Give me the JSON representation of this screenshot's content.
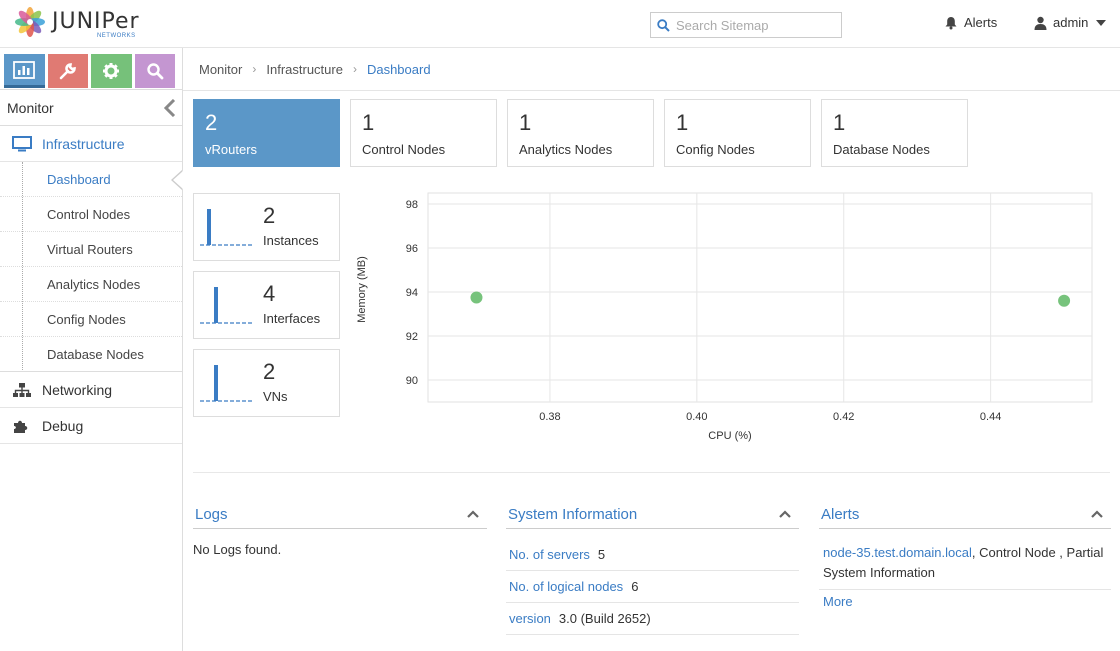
{
  "header": {
    "logo_text": "JUNIPer",
    "logo_sub": "NETWORKS",
    "search_placeholder": "Search Sitemap",
    "alerts_label": "Alerts",
    "user_label": "admin"
  },
  "sidebar": {
    "title": "Monitor",
    "sections": {
      "infrastructure": "Infrastructure",
      "networking": "Networking",
      "debug": "Debug"
    },
    "items": [
      "Dashboard",
      "Control Nodes",
      "Virtual Routers",
      "Analytics Nodes",
      "Config Nodes",
      "Database Nodes"
    ],
    "tab_colors": {
      "monitor": "#5b97c8",
      "configure": "#e07a73",
      "setting": "#76c17a",
      "query": "#c496d1"
    }
  },
  "breadcrumb": {
    "level1": "Monitor",
    "level2": "Infrastructure",
    "current": "Dashboard"
  },
  "tiles": [
    {
      "count": "2",
      "label": "vRouters"
    },
    {
      "count": "1",
      "label": "Control Nodes"
    },
    {
      "count": "1",
      "label": "Analytics Nodes"
    },
    {
      "count": "1",
      "label": "Config Nodes"
    },
    {
      "count": "1",
      "label": "Database Nodes"
    }
  ],
  "sparks": [
    {
      "count": "2",
      "label": "Instances"
    },
    {
      "count": "4",
      "label": "Interfaces"
    },
    {
      "count": "2",
      "label": "VNs"
    }
  ],
  "chart_data": {
    "type": "scatter",
    "xlabel": "CPU (%)",
    "ylabel": "Memory (MB)",
    "xlim": [
      0.3634,
      0.4538
    ],
    "ylim": [
      89.0,
      98.5
    ],
    "xticks": [
      "0.38",
      "0.40",
      "0.42",
      "0.44"
    ],
    "yticks": [
      "98",
      "96",
      "94",
      "92",
      "90"
    ],
    "grid": true,
    "point_color": "#77c37c",
    "points": [
      {
        "x": 0.37,
        "y": 93.75
      },
      {
        "x": 0.45,
        "y": 93.6
      }
    ]
  },
  "logs": {
    "title": "Logs",
    "empty_text": "No Logs found."
  },
  "system_info": {
    "title": "System Information",
    "rows": [
      {
        "key": "No. of servers",
        "value": "5"
      },
      {
        "key": "No. of logical nodes",
        "value": "6"
      },
      {
        "key": "version",
        "value": "3.0 (Build 2652)"
      }
    ]
  },
  "alerts": {
    "title": "Alerts",
    "node": "node-35.test.domain.local",
    "text": ", Control Node , Partial System Information",
    "more": "More"
  }
}
